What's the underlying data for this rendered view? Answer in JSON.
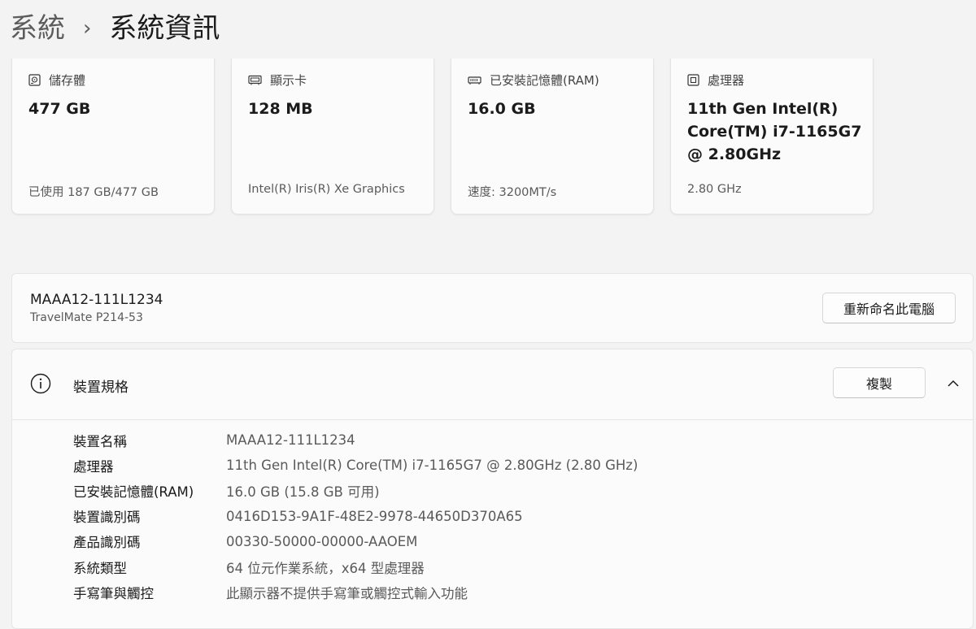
{
  "breadcrumb": {
    "parent": "系統",
    "separator": "›",
    "current": "系統資訊"
  },
  "cards": [
    {
      "icon": "storage-icon",
      "title": "儲存體",
      "value": "477 GB",
      "sub": "已使用 187 GB/477 GB"
    },
    {
      "icon": "graphics-card-icon",
      "title": "顯示卡",
      "value": "128 MB",
      "sub": "Intel(R) Iris(R) Xe Graphics"
    },
    {
      "icon": "memory-icon",
      "title": "已安裝記憶體(RAM)",
      "value": "16.0 GB",
      "sub": "速度: 3200MT/s"
    },
    {
      "icon": "processor-icon",
      "title": "處理器",
      "value": "11th Gen Intel(R) Core(TM) i7-1165G7 @ 2.80GHz",
      "sub": "2.80 GHz"
    }
  ],
  "device": {
    "name": "MAAA12-111L1234",
    "model": "TravelMate P214-53",
    "rename_label": "重新命名此電腦"
  },
  "specs": {
    "title": "裝置規格",
    "copy_label": "複製",
    "rows": [
      {
        "key": "裝置名稱",
        "value": "MAAA12-111L1234"
      },
      {
        "key": "處理器",
        "value": "11th Gen Intel(R) Core(TM) i7-1165G7 @ 2.80GHz (2.80 GHz)"
      },
      {
        "key": "已安裝記憶體(RAM)",
        "value": "16.0 GB (15.8 GB 可用)"
      },
      {
        "key": "裝置識別碼",
        "value": "0416D153-9A1F-48E2-9978-44650D370A65"
      },
      {
        "key": "產品識別碼",
        "value": "00330-50000-00000-AAOEM"
      },
      {
        "key": "系統類型",
        "value": "64 位元作業系統，x64 型處理器"
      },
      {
        "key": "手寫筆與觸控",
        "value": "此顯示器不提供手寫筆或觸控式輸入功能"
      }
    ]
  }
}
